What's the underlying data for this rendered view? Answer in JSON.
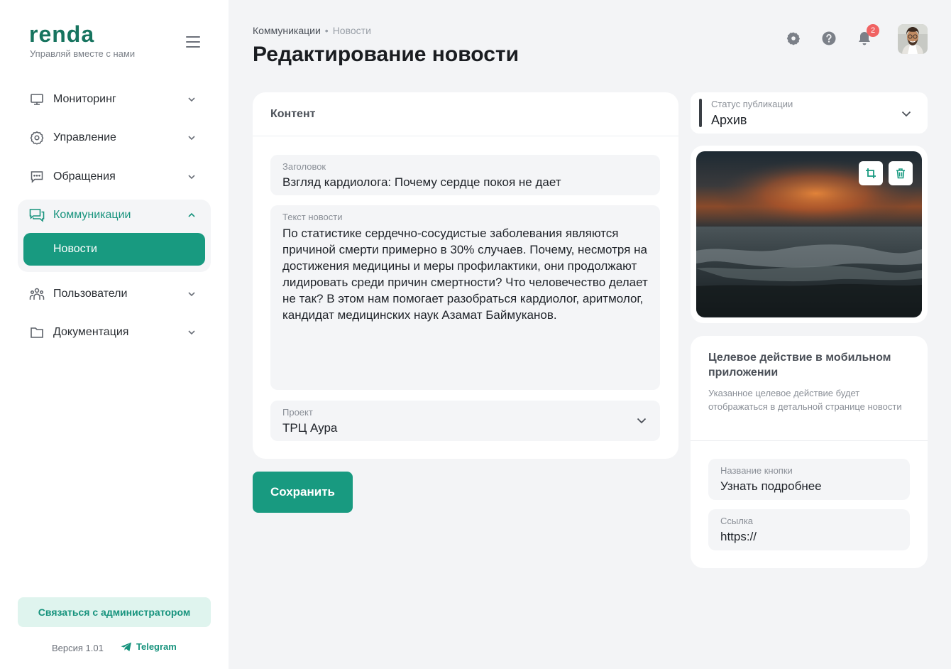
{
  "brand": {
    "logo": "renda",
    "tagline": "Управляй вместе с нами"
  },
  "sidebar": {
    "items": [
      {
        "label": "Мониторинг",
        "icon": "monitor-icon"
      },
      {
        "label": "Управление",
        "icon": "gear-icon"
      },
      {
        "label": "Обращения",
        "icon": "chat-icon"
      },
      {
        "label": "Коммуникации",
        "icon": "messages-icon",
        "expanded": true
      },
      {
        "label": "Пользователи",
        "icon": "users-icon"
      },
      {
        "label": "Документация",
        "icon": "folder-icon"
      }
    ],
    "active_subitem": "Новости",
    "contact_button": "Связаться с администратором",
    "version": "Версия 1.01",
    "telegram": "Telegram"
  },
  "header": {
    "breadcrumb": [
      "Коммуникации",
      "Новости"
    ],
    "title": "Редактирование новости",
    "notifications_count": "2"
  },
  "content": {
    "section_title": "Контент",
    "headline_label": "Заголовок",
    "headline_value": "Взгляд кардиолога: Почему сердце покоя не дает",
    "body_label": "Текст новости",
    "body_value": "По статистике сердечно-сосудистые заболевания являются причиной смерти примерно в 30% случаев. Почему, несмотря на достижения медицины и меры профилактики, они продолжают лидировать среди причин смертности? Что человечество делает не так? В этом нам помогает разобраться кардиолог, аритмолог, кандидат медицинских наук Азамат Баймуканов.",
    "project_label": "Проект",
    "project_value": "ТРЦ Аура",
    "save_label": "Сохранить"
  },
  "status": {
    "label": "Статус публикации",
    "value": "Архив"
  },
  "mobile_action": {
    "title": "Целевое действие в мобильном приложении",
    "description": "Указанное целевое действие будет отображаться в детальной странице новости",
    "button_name_label": "Название кнопки",
    "button_name_value": "Узнать подробнее",
    "link_label": "Ссылка",
    "link_value": "https://"
  },
  "colors": {
    "accent": "#189a80",
    "accent_text": "#17937d",
    "badge": "#f06363",
    "background": "#f3f4f6"
  }
}
